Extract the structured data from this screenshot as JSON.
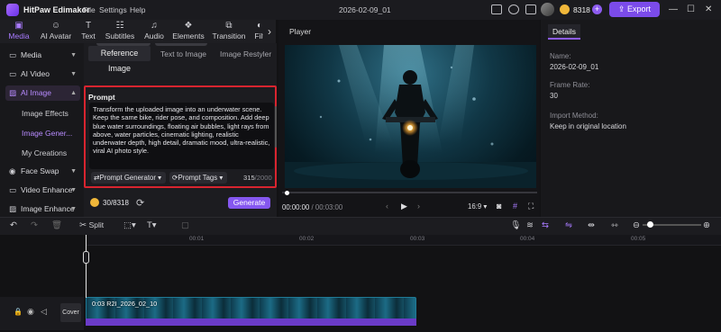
{
  "titlebar": {
    "app_name": "HitPaw Edimakor",
    "menus": [
      "File",
      "Settings",
      "Help"
    ],
    "project_title": "2026-02-09_01",
    "credits": "8318",
    "export_label": "Export"
  },
  "toolbar": {
    "items": [
      {
        "label": "Media",
        "icon": "media-icon"
      },
      {
        "label": "AI Avatar",
        "icon": "ai-avatar-icon"
      },
      {
        "label": "Text",
        "icon": "text-icon"
      },
      {
        "label": "Subtitles",
        "icon": "subtitles-icon"
      },
      {
        "label": "Audio",
        "icon": "audio-icon"
      },
      {
        "label": "Elements",
        "icon": "elements-icon"
      },
      {
        "label": "Transition",
        "icon": "transition-icon"
      },
      {
        "label": "Filt",
        "icon": "filter-icon"
      }
    ],
    "active": "Media"
  },
  "sidebar": {
    "items": [
      {
        "label": "Media",
        "expanded": false
      },
      {
        "label": "AI Video",
        "expanded": false
      },
      {
        "label": "AI Image",
        "expanded": true,
        "selected": true
      },
      {
        "label": "Face Swap",
        "expanded": false
      },
      {
        "label": "Video Enhance",
        "expanded": false
      },
      {
        "label": "Image Enhance",
        "expanded": false
      }
    ],
    "sub_items": [
      "Image Effects",
      "Image Gener...",
      "My Creations"
    ],
    "sub_selected": "Image Gener..."
  },
  "ai_panel": {
    "tabs": [
      "Reference Image",
      "Text to Image",
      "Image Restyler"
    ],
    "active_tab": "Reference Image",
    "prompt_heading": "Prompt",
    "prompt_text": "Transform the uploaded image into an underwater scene. Keep the same bike, rider pose, and composition. Add deep blue water surroundings, floating air bubbles, light rays from above, water particles, cinematic lighting, realistic underwater depth, high detail, dramatic mood, ultra-realistic, viral AI photo style.",
    "prompt_generator_label": "Prompt Generator",
    "prompt_tags_label": "Prompt Tags",
    "char_count": "315",
    "char_limit": "/2000",
    "credit_usage": "30/8318",
    "generate_label": "Generate"
  },
  "player": {
    "heading": "Player",
    "current_time": "00:00:00",
    "total_time": " / 00:03:00",
    "aspect_ratio": "16:9"
  },
  "details": {
    "tab": "Details",
    "fields": [
      {
        "label": "Name:",
        "value": "2026-02-09_01"
      },
      {
        "label": "Frame Rate:",
        "value": "30"
      },
      {
        "label": "Import Method:",
        "value": "Keep in original location"
      }
    ]
  },
  "timeline": {
    "split_label": "Split",
    "ruler_ticks": [
      "00:01",
      "00:02",
      "00:03",
      "00:04",
      "00:05"
    ],
    "cover_label": "Cover",
    "clip_label": "0:03 R2I_2026_02_10"
  },
  "colors": {
    "accent": "#7b4bea",
    "highlight_border": "#d8242f",
    "selected_text": "#b88bff"
  }
}
